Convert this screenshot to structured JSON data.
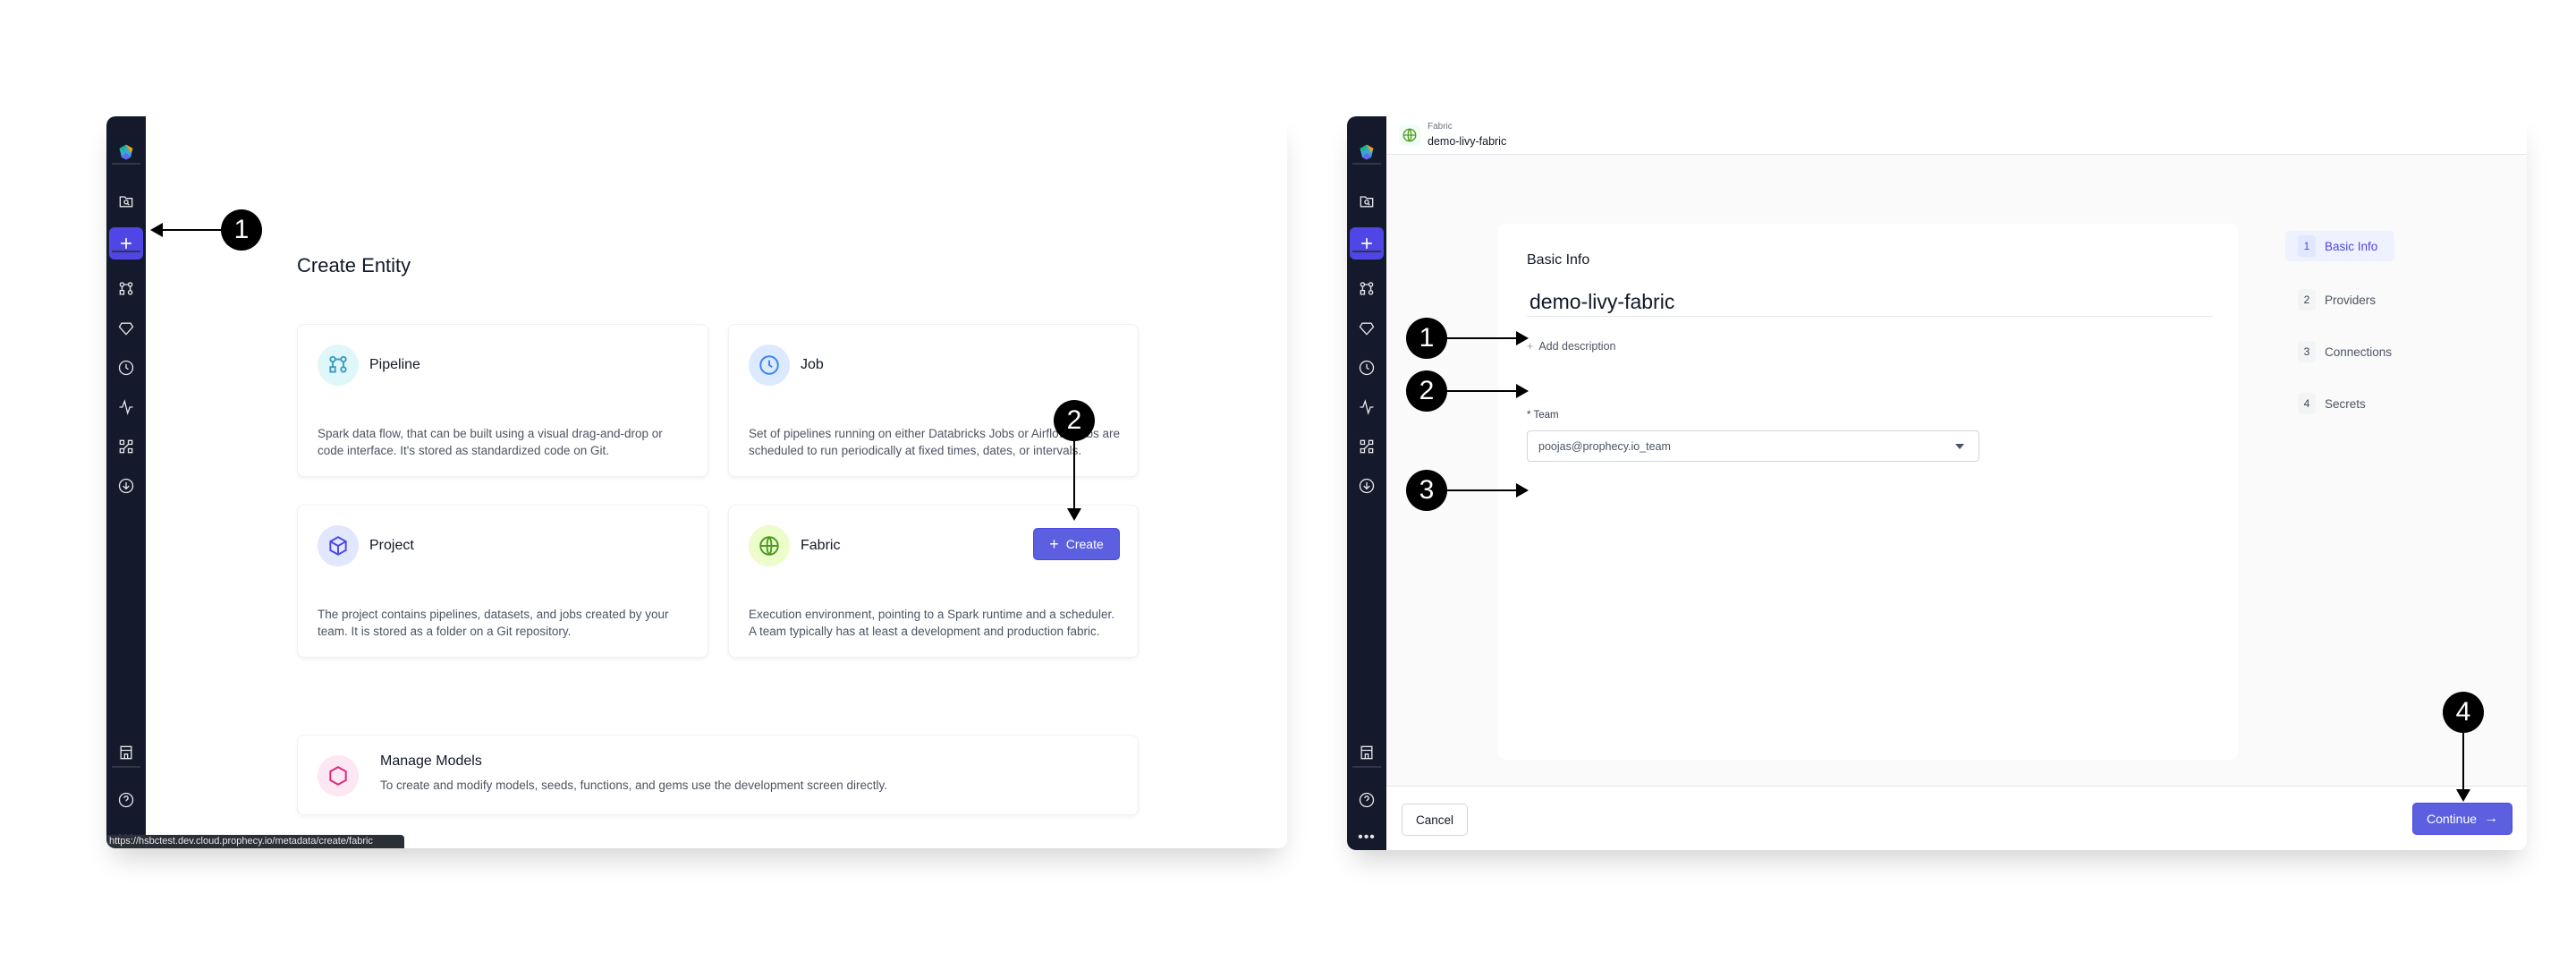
{
  "left": {
    "title": "Create Entity",
    "cards": [
      {
        "title": "Pipeline",
        "icon": "pipeline-icon",
        "desc": "Spark data flow, that can be built using a visual drag-and-drop or code interface. It's stored as standardized code on Git."
      },
      {
        "title": "Job",
        "icon": "clock-icon",
        "desc": "Set of pipelines running on either Databricks Jobs or Airflow. Jobs are scheduled to run periodically at fixed times, dates, or intervals."
      },
      {
        "title": "Project",
        "icon": "cube-icon",
        "desc": "The project contains pipelines, datasets, and jobs created by your team. It is stored as a folder on a Git repository."
      },
      {
        "title": "Fabric",
        "icon": "globe-icon",
        "desc": "Execution environment, pointing to a Spark runtime and a scheduler. A team typically has at least a development and production fabric."
      }
    ],
    "create_button": "Create",
    "manage": {
      "title": "Manage Models",
      "desc": "To create and modify models, seeds, functions, and gems use the development screen directly."
    },
    "status_url": "https://hsbctest.dev.cloud.prophecy.io/metadata/create/fabric"
  },
  "right": {
    "header": {
      "type": "Fabric",
      "name": "demo-livy-fabric"
    },
    "section_title": "Basic Info",
    "name_value": "demo-livy-fabric",
    "add_description": "Add description",
    "team_label": "* Team",
    "team_value": "poojas@prophecy.io_team",
    "steps": [
      {
        "num": "1",
        "label": "Basic Info",
        "active": true
      },
      {
        "num": "2",
        "label": "Providers"
      },
      {
        "num": "3",
        "label": "Connections"
      },
      {
        "num": "4",
        "label": "Secrets"
      }
    ],
    "cancel": "Cancel",
    "continue": "Continue"
  },
  "annotations": {
    "left": [
      "1",
      "2"
    ],
    "right": [
      "1",
      "2",
      "3",
      "4"
    ]
  },
  "colors": {
    "accent": "#5b5fe0",
    "sidebar": "#141a2b"
  }
}
